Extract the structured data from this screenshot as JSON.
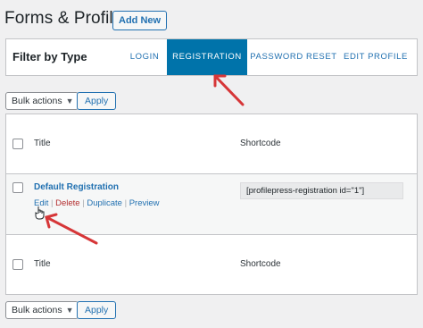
{
  "header": {
    "title": "Forms & Profiles",
    "add_new": "Add New"
  },
  "filter": {
    "label": "Filter by Type",
    "tabs": [
      "LOGIN",
      "REGISTRATION",
      "PASSWORD RESET",
      "EDIT PROFILE"
    ],
    "active_tab": "REGISTRATION"
  },
  "bulk": {
    "label": "Bulk actions",
    "apply": "Apply"
  },
  "table": {
    "columns": [
      "Title",
      "Shortcode"
    ],
    "rows": [
      {
        "title": "Default Registration",
        "actions": [
          "Edit",
          "Delete",
          "Duplicate",
          "Preview"
        ],
        "shortcode": "[profilepress-registration id=\"1\"]"
      }
    ]
  },
  "colors": {
    "accent": "#2271b1",
    "active_tab": "#0073aa",
    "annotation_arrow": "#d63638",
    "delete": "#b32d2e"
  }
}
